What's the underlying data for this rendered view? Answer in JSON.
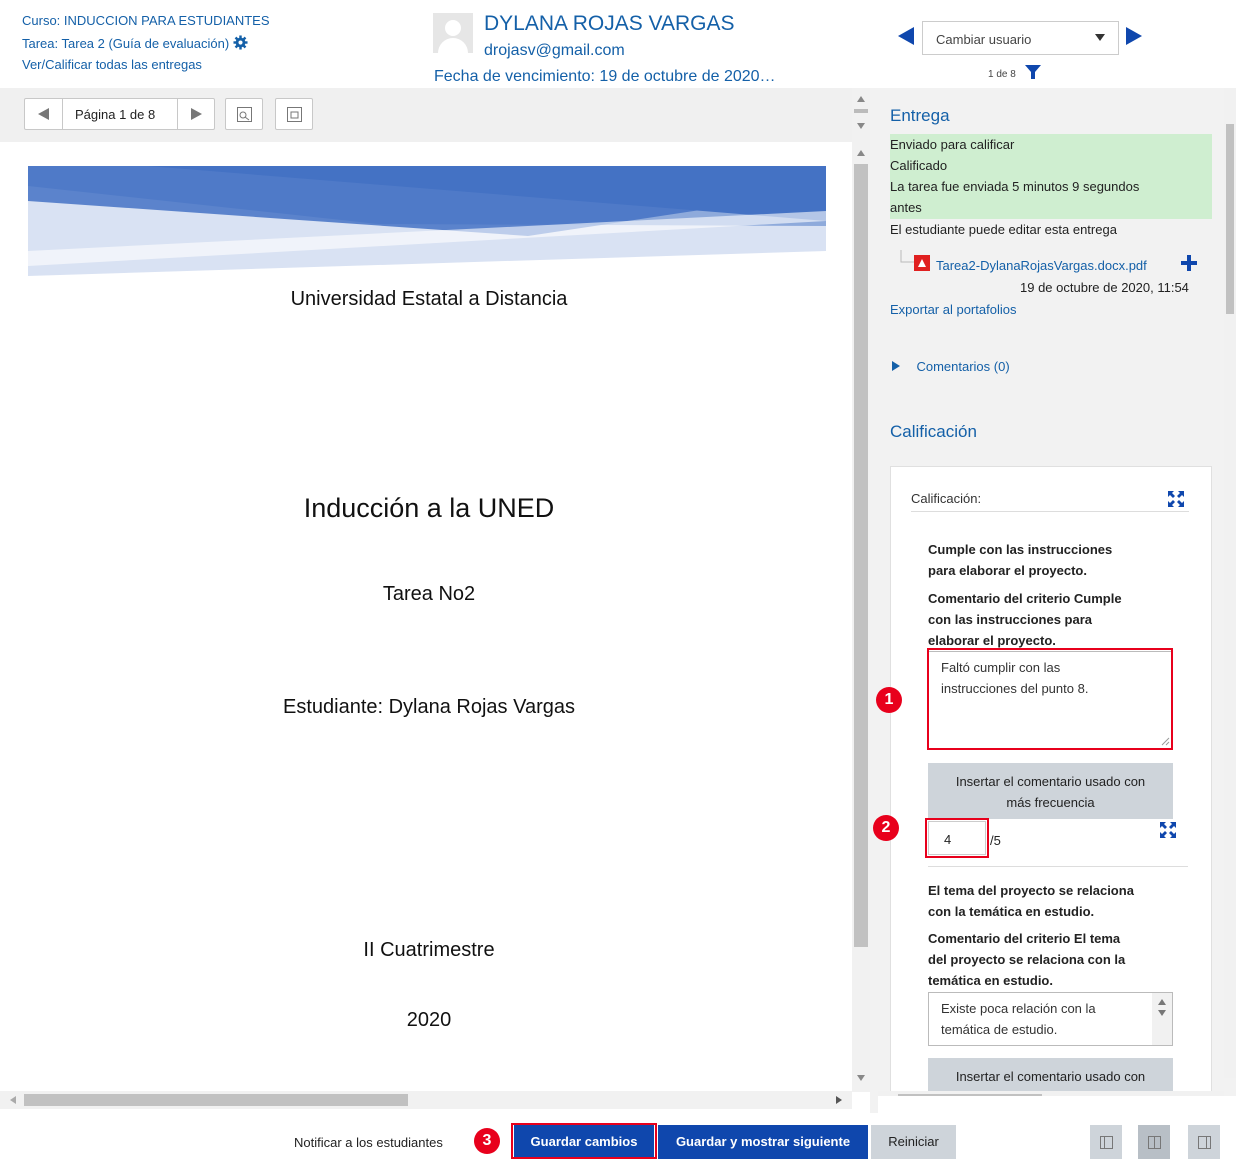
{
  "header": {
    "course_link": "Curso: INDUCCION PARA ESTUDIANTES",
    "assignment_link": "Tarea: Tarea 2 (Guía de evaluación)",
    "view_all_link": "Ver/Calificar todas las entregas",
    "student_name": "DYLANA ROJAS VARGAS",
    "student_email": "drojasv@gmail.com",
    "due_date": "Fecha de vencimiento: 19 de octubre de 2020…",
    "change_user_label": "Cambiar usuario",
    "user_count": "1 de 8"
  },
  "pdf_toolbar": {
    "page_label": "Página 1 de 8"
  },
  "pdf_document": {
    "university": "Universidad Estatal a Distancia",
    "title": "Inducción a la UNED",
    "assignment": "Tarea No2",
    "student": "Estudiante: Dylana Rojas Vargas",
    "term": "II Cuatrimestre",
    "year": "2020",
    "banner_colors": [
      "#4472c4",
      "#8eaadb",
      "#d9e2f3"
    ]
  },
  "submission": {
    "section_title": "Entrega",
    "status_lines": [
      "Enviado para calificar",
      "Calificado",
      "La tarea fue enviada 5 minutos 9 segundos",
      "antes"
    ],
    "edit_note": "El estudiante puede editar esta entrega",
    "file_name": "Tarea2-DylanaRojasVargas.docx.pdf",
    "file_date": "19 de octubre de 2020, 11:54",
    "export_link": "Exportar al portafolios",
    "comments_label": "Comentarios (0)"
  },
  "grading": {
    "section_title": "Calificación",
    "panel_label": "Calificación:",
    "criterion1_lines": [
      "Cumple con las instrucciones",
      "para elaborar el proyecto."
    ],
    "criterion1_comment_label_lines": [
      "Comentario del criterio Cumple",
      "con las instrucciones para",
      "elaborar el proyecto."
    ],
    "criterion1_comment_lines": [
      "Faltó cumplir con las",
      "instrucciones del punto 8."
    ],
    "insert_button_lines": [
      "Insertar el comentario usado con",
      "más frecuencia"
    ],
    "criterion1_score": "4",
    "criterion1_max": "/5",
    "criterion2_lines": [
      "El tema del proyecto se relaciona",
      "con la temática en estudio."
    ],
    "criterion2_comment_label_lines": [
      "Comentario del criterio El tema",
      "del proyecto se relaciona con la",
      "temática en estudio."
    ],
    "criterion2_comment_lines": [
      "Existe poca relación con la",
      "temática de estudio."
    ],
    "insert_button2_line": "Insertar el comentario usado con"
  },
  "footer": {
    "notify_label": "Notificar a los estudiantes",
    "save_button": "Guardar cambios",
    "save_next_button": "Guardar y mostrar siguiente",
    "reset_button": "Reiniciar"
  },
  "markers": [
    "1",
    "2",
    "3"
  ],
  "colors": {
    "link": "#1460a8",
    "primary": "#0f47ad",
    "success_bg": "#cfeed0",
    "marker": "#e8001c"
  }
}
